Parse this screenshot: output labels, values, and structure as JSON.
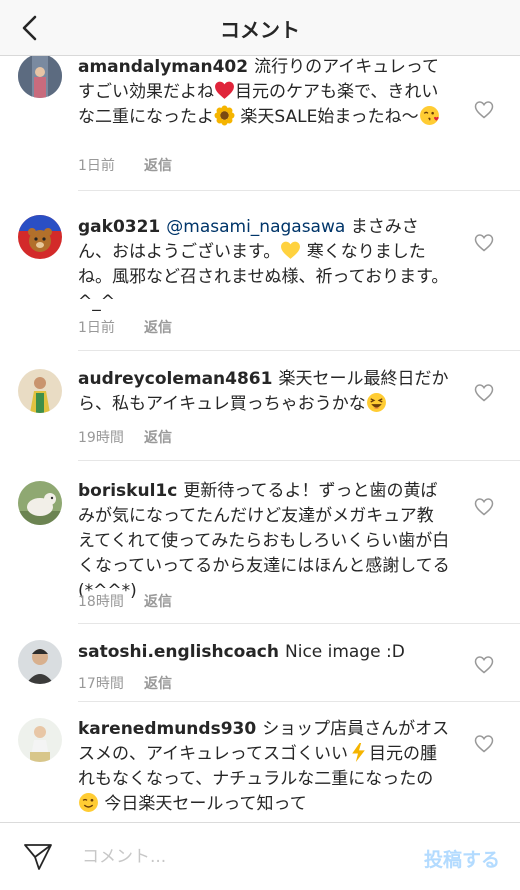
{
  "header": {
    "title": "コメント",
    "back_icon": "chevron-left-icon"
  },
  "comments": [
    {
      "user": "amandalyman402",
      "text_parts": [
        "流行りのアイキュレってすごい効果だよね",
        "目元のケアも楽で、きれいな二重になったよ",
        " 楽天SALE始まったね〜"
      ],
      "time": "1日前",
      "reply": "返信"
    },
    {
      "user": "gak0321",
      "mention": "@masami_nagasawa",
      "text_parts": [
        " まさみさん、おはようございます。",
        " 寒くなりましたね。風邪など召されませぬ様、祈っております。^_^"
      ],
      "time": "1日前",
      "reply": "返信"
    },
    {
      "user": "audreycoleman4861",
      "text_parts": [
        "楽天セール最終日だから、私もアイキュレ買っちゃおうかな"
      ],
      "time": "19時間",
      "reply": "返信"
    },
    {
      "user": "boriskul1c",
      "text_parts": [
        "更新待ってるよ！ずっと歯の黄ばみが気になってたんだけど友達がメガキュア教えてくれて使ってみたらおもしろいくらい歯が白くなっていってるから友達にはほんと感謝してる(*^^*)"
      ],
      "time": "18時間",
      "reply": "返信"
    },
    {
      "user": "satoshi.englishcoach",
      "text_parts": [
        "Nice image :D"
      ],
      "time": "17時間",
      "reply": "返信"
    },
    {
      "user": "karenedmunds930",
      "text_parts": [
        "ショップ店員さんがオススメの、アイキュレってスゴくいい",
        "目元の腫れもなくなって、ナチュラルな二重になったの",
        " 今日楽天セールって知って"
      ],
      "time": "",
      "reply": ""
    }
  ],
  "composer": {
    "placeholder": "コメント...",
    "post_label": "投稿する",
    "send_icon": "paper-plane-icon"
  },
  "colors": {
    "text": "#262626",
    "meta": "#999999",
    "mention": "#003569",
    "post_disabled": "#b3dbff"
  }
}
